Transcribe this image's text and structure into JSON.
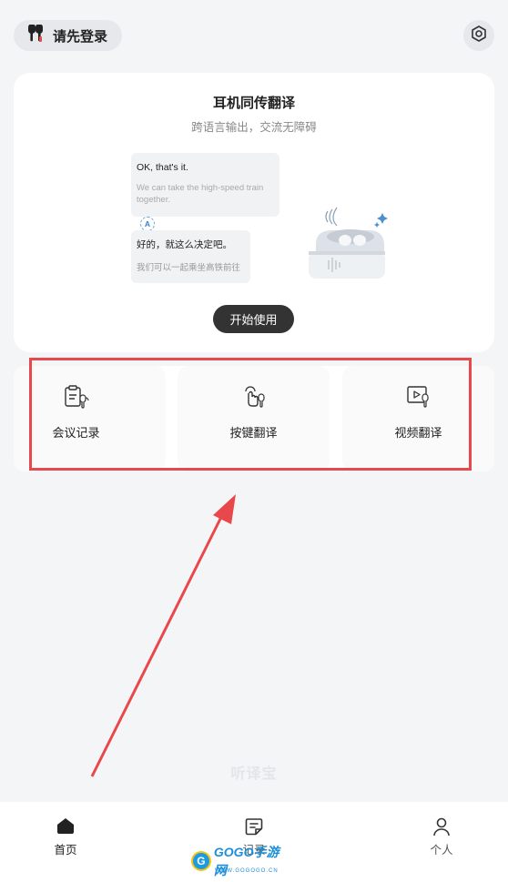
{
  "header": {
    "login_label": "请先登录",
    "earbuds_icon": "earbuds-icon",
    "settings_icon": "settings-icon"
  },
  "hero": {
    "title": "耳机同传翻译",
    "subtitle": "跨语言输出，交流无障碍",
    "bubble_en": "OK, that's it.",
    "bubble_en_translation": "We can take the high-speed train together.",
    "bubble_cn": "好的，就这么决定吧。",
    "bubble_cn_translation": "我们可以一起乘坐高铁前往",
    "lang_badge": "A",
    "start_button": "开始使用"
  },
  "features": [
    {
      "label": "会议记录",
      "icon": "meeting-record-icon"
    },
    {
      "label": "按键翻译",
      "icon": "button-translate-icon"
    },
    {
      "label": "视频翻译",
      "icon": "video-translate-icon"
    }
  ],
  "brand_text": "听译宝",
  "tabs": [
    {
      "label": "首页",
      "icon": "home-icon",
      "active": true
    },
    {
      "label": "记录",
      "icon": "record-icon",
      "active": false
    },
    {
      "label": "个人",
      "icon": "profile-icon",
      "active": false
    }
  ],
  "watermark": {
    "logo": "G",
    "text": "GOGO手游网",
    "url": "WWW.GOGOGO.CN"
  },
  "colors": {
    "background": "#f4f5f7",
    "card": "#ffffff",
    "primary_button": "#333333",
    "annotation": "#e8474b"
  }
}
